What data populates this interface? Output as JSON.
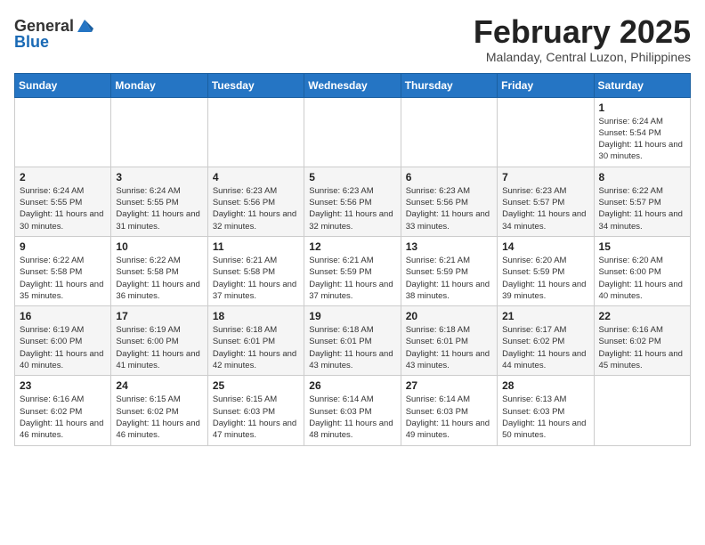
{
  "logo": {
    "general": "General",
    "blue": "Blue"
  },
  "title": {
    "month": "February 2025",
    "location": "Malanday, Central Luzon, Philippines"
  },
  "weekdays": [
    "Sunday",
    "Monday",
    "Tuesday",
    "Wednesday",
    "Thursday",
    "Friday",
    "Saturday"
  ],
  "weeks": [
    [
      {
        "day": "",
        "info": ""
      },
      {
        "day": "",
        "info": ""
      },
      {
        "day": "",
        "info": ""
      },
      {
        "day": "",
        "info": ""
      },
      {
        "day": "",
        "info": ""
      },
      {
        "day": "",
        "info": ""
      },
      {
        "day": "1",
        "info": "Sunrise: 6:24 AM\nSunset: 5:54 PM\nDaylight: 11 hours and 30 minutes."
      }
    ],
    [
      {
        "day": "2",
        "info": "Sunrise: 6:24 AM\nSunset: 5:55 PM\nDaylight: 11 hours and 30 minutes."
      },
      {
        "day": "3",
        "info": "Sunrise: 6:24 AM\nSunset: 5:55 PM\nDaylight: 11 hours and 31 minutes."
      },
      {
        "day": "4",
        "info": "Sunrise: 6:23 AM\nSunset: 5:56 PM\nDaylight: 11 hours and 32 minutes."
      },
      {
        "day": "5",
        "info": "Sunrise: 6:23 AM\nSunset: 5:56 PM\nDaylight: 11 hours and 32 minutes."
      },
      {
        "day": "6",
        "info": "Sunrise: 6:23 AM\nSunset: 5:56 PM\nDaylight: 11 hours and 33 minutes."
      },
      {
        "day": "7",
        "info": "Sunrise: 6:23 AM\nSunset: 5:57 PM\nDaylight: 11 hours and 34 minutes."
      },
      {
        "day": "8",
        "info": "Sunrise: 6:22 AM\nSunset: 5:57 PM\nDaylight: 11 hours and 34 minutes."
      }
    ],
    [
      {
        "day": "9",
        "info": "Sunrise: 6:22 AM\nSunset: 5:58 PM\nDaylight: 11 hours and 35 minutes."
      },
      {
        "day": "10",
        "info": "Sunrise: 6:22 AM\nSunset: 5:58 PM\nDaylight: 11 hours and 36 minutes."
      },
      {
        "day": "11",
        "info": "Sunrise: 6:21 AM\nSunset: 5:58 PM\nDaylight: 11 hours and 37 minutes."
      },
      {
        "day": "12",
        "info": "Sunrise: 6:21 AM\nSunset: 5:59 PM\nDaylight: 11 hours and 37 minutes."
      },
      {
        "day": "13",
        "info": "Sunrise: 6:21 AM\nSunset: 5:59 PM\nDaylight: 11 hours and 38 minutes."
      },
      {
        "day": "14",
        "info": "Sunrise: 6:20 AM\nSunset: 5:59 PM\nDaylight: 11 hours and 39 minutes."
      },
      {
        "day": "15",
        "info": "Sunrise: 6:20 AM\nSunset: 6:00 PM\nDaylight: 11 hours and 40 minutes."
      }
    ],
    [
      {
        "day": "16",
        "info": "Sunrise: 6:19 AM\nSunset: 6:00 PM\nDaylight: 11 hours and 40 minutes."
      },
      {
        "day": "17",
        "info": "Sunrise: 6:19 AM\nSunset: 6:00 PM\nDaylight: 11 hours and 41 minutes."
      },
      {
        "day": "18",
        "info": "Sunrise: 6:18 AM\nSunset: 6:01 PM\nDaylight: 11 hours and 42 minutes."
      },
      {
        "day": "19",
        "info": "Sunrise: 6:18 AM\nSunset: 6:01 PM\nDaylight: 11 hours and 43 minutes."
      },
      {
        "day": "20",
        "info": "Sunrise: 6:18 AM\nSunset: 6:01 PM\nDaylight: 11 hours and 43 minutes."
      },
      {
        "day": "21",
        "info": "Sunrise: 6:17 AM\nSunset: 6:02 PM\nDaylight: 11 hours and 44 minutes."
      },
      {
        "day": "22",
        "info": "Sunrise: 6:16 AM\nSunset: 6:02 PM\nDaylight: 11 hours and 45 minutes."
      }
    ],
    [
      {
        "day": "23",
        "info": "Sunrise: 6:16 AM\nSunset: 6:02 PM\nDaylight: 11 hours and 46 minutes."
      },
      {
        "day": "24",
        "info": "Sunrise: 6:15 AM\nSunset: 6:02 PM\nDaylight: 11 hours and 46 minutes."
      },
      {
        "day": "25",
        "info": "Sunrise: 6:15 AM\nSunset: 6:03 PM\nDaylight: 11 hours and 47 minutes."
      },
      {
        "day": "26",
        "info": "Sunrise: 6:14 AM\nSunset: 6:03 PM\nDaylight: 11 hours and 48 minutes."
      },
      {
        "day": "27",
        "info": "Sunrise: 6:14 AM\nSunset: 6:03 PM\nDaylight: 11 hours and 49 minutes."
      },
      {
        "day": "28",
        "info": "Sunrise: 6:13 AM\nSunset: 6:03 PM\nDaylight: 11 hours and 50 minutes."
      },
      {
        "day": "",
        "info": ""
      }
    ]
  ]
}
